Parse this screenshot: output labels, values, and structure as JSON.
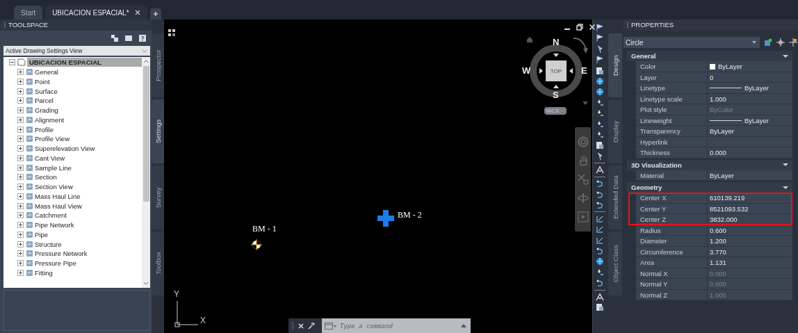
{
  "tabs": [
    {
      "label": "Start",
      "selected": false
    },
    {
      "label": "UBICACION ESPACIAL*",
      "selected": true
    }
  ],
  "toolspace": {
    "title": "TOOLSPACE",
    "view": "Active Drawing Settings View",
    "tree": {
      "label": "UBICACION ESPACIAL",
      "expanded": true,
      "selected": true,
      "children": [
        {
          "label": "General",
          "expanded": false
        },
        {
          "label": "Point",
          "expanded": false
        },
        {
          "label": "Surface",
          "expanded": false
        },
        {
          "label": "Parcel",
          "expanded": false
        },
        {
          "label": "Grading",
          "expanded": false
        },
        {
          "label": "Alignment",
          "expanded": false
        },
        {
          "label": "Profile",
          "expanded": false
        },
        {
          "label": "Profile View",
          "expanded": false
        },
        {
          "label": "Superelevation View",
          "expanded": false
        },
        {
          "label": "Cant View",
          "expanded": false
        },
        {
          "label": "Sample Line",
          "expanded": false
        },
        {
          "label": "Section",
          "expanded": false
        },
        {
          "label": "Section View",
          "expanded": false
        },
        {
          "label": "Mass Haul Line",
          "expanded": false
        },
        {
          "label": "Mass Haul View",
          "expanded": false
        },
        {
          "label": "Catchment",
          "expanded": false
        },
        {
          "label": "Pipe Network",
          "expanded": false
        },
        {
          "label": "Pipe",
          "expanded": false
        },
        {
          "label": "Structure",
          "expanded": false
        },
        {
          "label": "Pressure Network",
          "expanded": false
        },
        {
          "label": "Pressure Pipe",
          "expanded": false
        },
        {
          "label": "Fitting",
          "expanded": false
        }
      ]
    },
    "side_tabs": [
      {
        "label": "Prospector",
        "selected": false
      },
      {
        "label": "Settings",
        "selected": true
      },
      {
        "label": "Survey",
        "selected": false
      },
      {
        "label": "Toolbox",
        "selected": false
      }
    ]
  },
  "canvas": {
    "viewcube": {
      "north": "N",
      "south": "S",
      "east": "E",
      "west": "W",
      "face": "TOP",
      "ucs": "WCS"
    },
    "labels": [
      {
        "text": "BM - 1",
        "kind": "benchmark"
      },
      {
        "text": "BM - 2",
        "kind": "block"
      }
    ],
    "axes": {
      "x": "X",
      "y": "Y"
    },
    "command_line": {
      "placeholder": "Type a command"
    }
  },
  "properties": {
    "title": "PROPERTIES",
    "object": "Circle",
    "side_tabs": [
      {
        "label": "Design",
        "selected": true
      },
      {
        "label": "Display",
        "selected": false
      },
      {
        "label": "Extended Data",
        "selected": false
      },
      {
        "label": "Object Class",
        "selected": false
      }
    ],
    "sections": [
      {
        "title": "General",
        "expanded": true,
        "rows": [
          {
            "label": "Color",
            "value": "ByLayer",
            "kind": "swatch",
            "disabled": false,
            "highlighted": false
          },
          {
            "label": "Layer",
            "value": "0",
            "kind": "text",
            "disabled": false,
            "highlighted": false
          },
          {
            "label": "Linetype",
            "value": "ByLayer",
            "kind": "line",
            "disabled": false,
            "highlighted": false
          },
          {
            "label": "Linetype scale",
            "value": "1.000",
            "kind": "text",
            "disabled": false,
            "highlighted": false
          },
          {
            "label": "Plot style",
            "value": "ByColor",
            "kind": "text",
            "disabled": true,
            "highlighted": false
          },
          {
            "label": "Lineweight",
            "value": "ByLayer",
            "kind": "line",
            "disabled": false,
            "highlighted": false
          },
          {
            "label": "Transparency",
            "value": "ByLayer",
            "kind": "text",
            "disabled": false,
            "highlighted": false
          },
          {
            "label": "Hyperlink",
            "kind": "text",
            "disabled": false,
            "highlighted": false
          },
          {
            "label": "Thickness",
            "value": "0.000",
            "kind": "text",
            "disabled": false,
            "highlighted": false
          }
        ]
      },
      {
        "title": "3D Visualization",
        "expanded": true,
        "rows": [
          {
            "label": "Material",
            "value": "ByLayer",
            "kind": "text",
            "disabled": false,
            "highlighted": false
          }
        ]
      },
      {
        "title": "Geometry",
        "expanded": true,
        "rows": [
          {
            "label": "Center X",
            "value": "610139.219",
            "kind": "text",
            "disabled": false,
            "highlighted": true
          },
          {
            "label": "Center Y",
            "value": "8521093.532",
            "kind": "text",
            "disabled": false,
            "highlighted": true
          },
          {
            "label": "Center Z",
            "value": "3832.000",
            "kind": "text",
            "disabled": false,
            "highlighted": true
          },
          {
            "label": "Radius",
            "value": "0.600",
            "kind": "text",
            "disabled": false,
            "highlighted": false
          },
          {
            "label": "Diameter",
            "value": "1.200",
            "kind": "text",
            "disabled": false,
            "highlighted": false
          },
          {
            "label": "Circumference",
            "value": "3.770",
            "kind": "text",
            "disabled": false,
            "highlighted": false
          },
          {
            "label": "Area",
            "value": "1.131",
            "kind": "text",
            "disabled": false,
            "highlighted": false
          },
          {
            "label": "Normal X",
            "value": "0.000",
            "kind": "text",
            "disabled": true,
            "highlighted": false
          },
          {
            "label": "Normal Y",
            "value": "0.000",
            "kind": "text",
            "disabled": true,
            "highlighted": false
          },
          {
            "label": "Normal Z",
            "value": "1.000",
            "kind": "text",
            "disabled": true,
            "highlighted": false
          }
        ]
      }
    ]
  }
}
